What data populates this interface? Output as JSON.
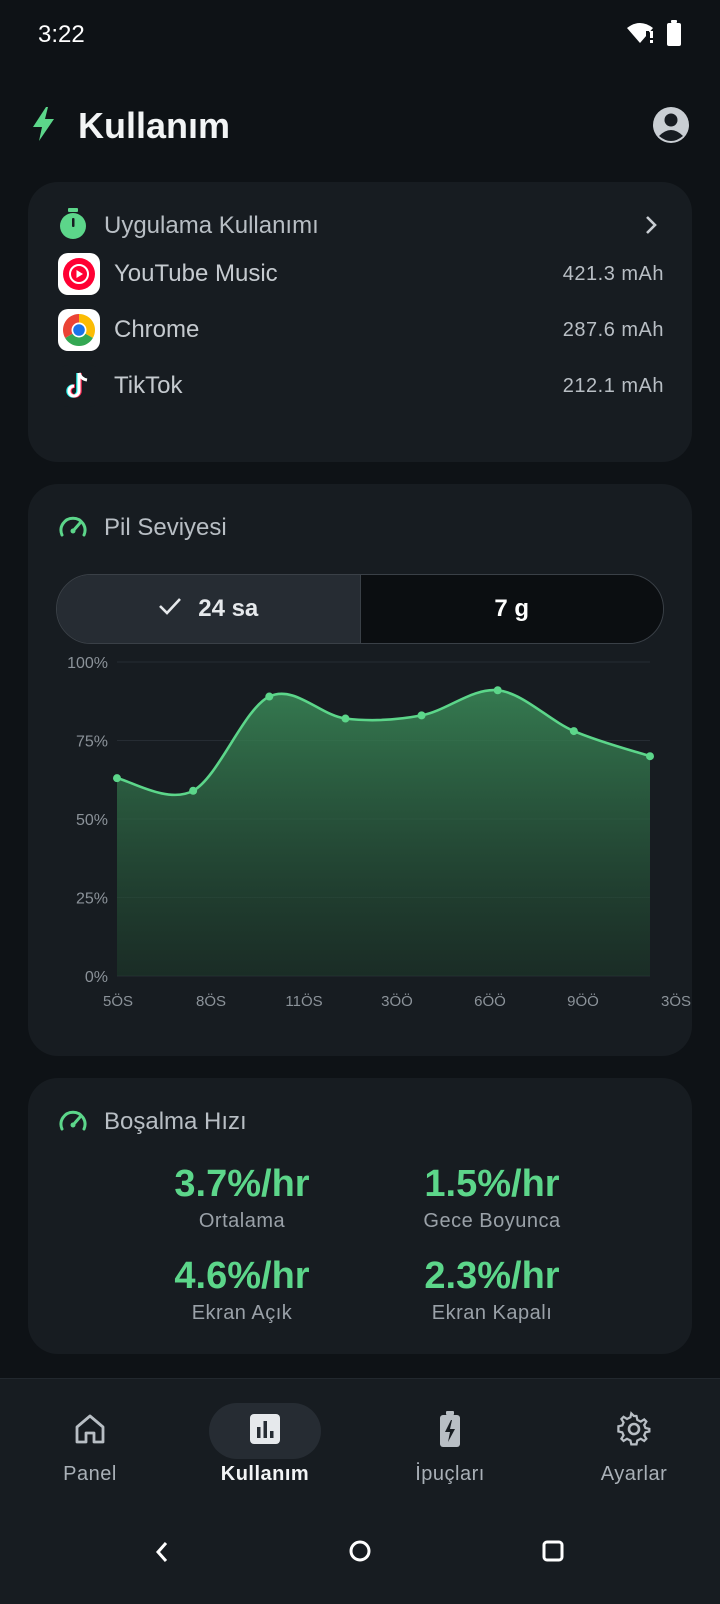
{
  "status": {
    "time": "3:22"
  },
  "header": {
    "title": "Kullanım"
  },
  "usage": {
    "title": "Uygulama Kullanımı",
    "apps": [
      {
        "name": "YouTube Music",
        "value": "421.3 mAh",
        "icon": "youtube-music-icon"
      },
      {
        "name": "Chrome",
        "value": "287.6 mAh",
        "icon": "chrome-icon"
      },
      {
        "name": "TikTok",
        "value": "212.1 mAh",
        "icon": "tiktok-icon"
      }
    ]
  },
  "battery": {
    "title": "Pil Seviyesi",
    "tabs": [
      {
        "label": "24 sa",
        "selected": true
      },
      {
        "label": "7 g",
        "selected": false
      }
    ]
  },
  "chart_data": {
    "type": "area",
    "title": "",
    "xlabel": "",
    "ylabel": "",
    "x": [
      "5ÖS",
      "8ÖS",
      "11ÖS",
      "3ÖÖ",
      "6ÖÖ",
      "9ÖÖ",
      "3ÖS"
    ],
    "y_ticks": [
      "0%",
      "25%",
      "50%",
      "75%",
      "100%"
    ],
    "ylim": [
      0,
      100
    ],
    "points": [
      63,
      59,
      89,
      82,
      83,
      91,
      78,
      70
    ],
    "grid": true,
    "line_color": "#5cd68a"
  },
  "drain": {
    "title": "Boşalma Hızı",
    "stats": [
      {
        "value": "3.7%/hr",
        "label": "Ortalama"
      },
      {
        "value": "1.5%/hr",
        "label": "Gece Boyunca"
      },
      {
        "value": "4.6%/hr",
        "label": "Ekran Açık"
      },
      {
        "value": "2.3%/hr",
        "label": "Ekran Kapalı"
      }
    ]
  },
  "nav": {
    "items": [
      {
        "label": "Panel",
        "icon": "home-icon"
      },
      {
        "label": "Kullanım",
        "icon": "bar-chart-icon",
        "active": true
      },
      {
        "label": "İpuçları",
        "icon": "battery-bolt-icon"
      },
      {
        "label": "Ayarlar",
        "icon": "gear-icon"
      }
    ]
  },
  "colors": {
    "accent": "#5cd68a",
    "card": "#171c21",
    "background": "#0e1216"
  }
}
